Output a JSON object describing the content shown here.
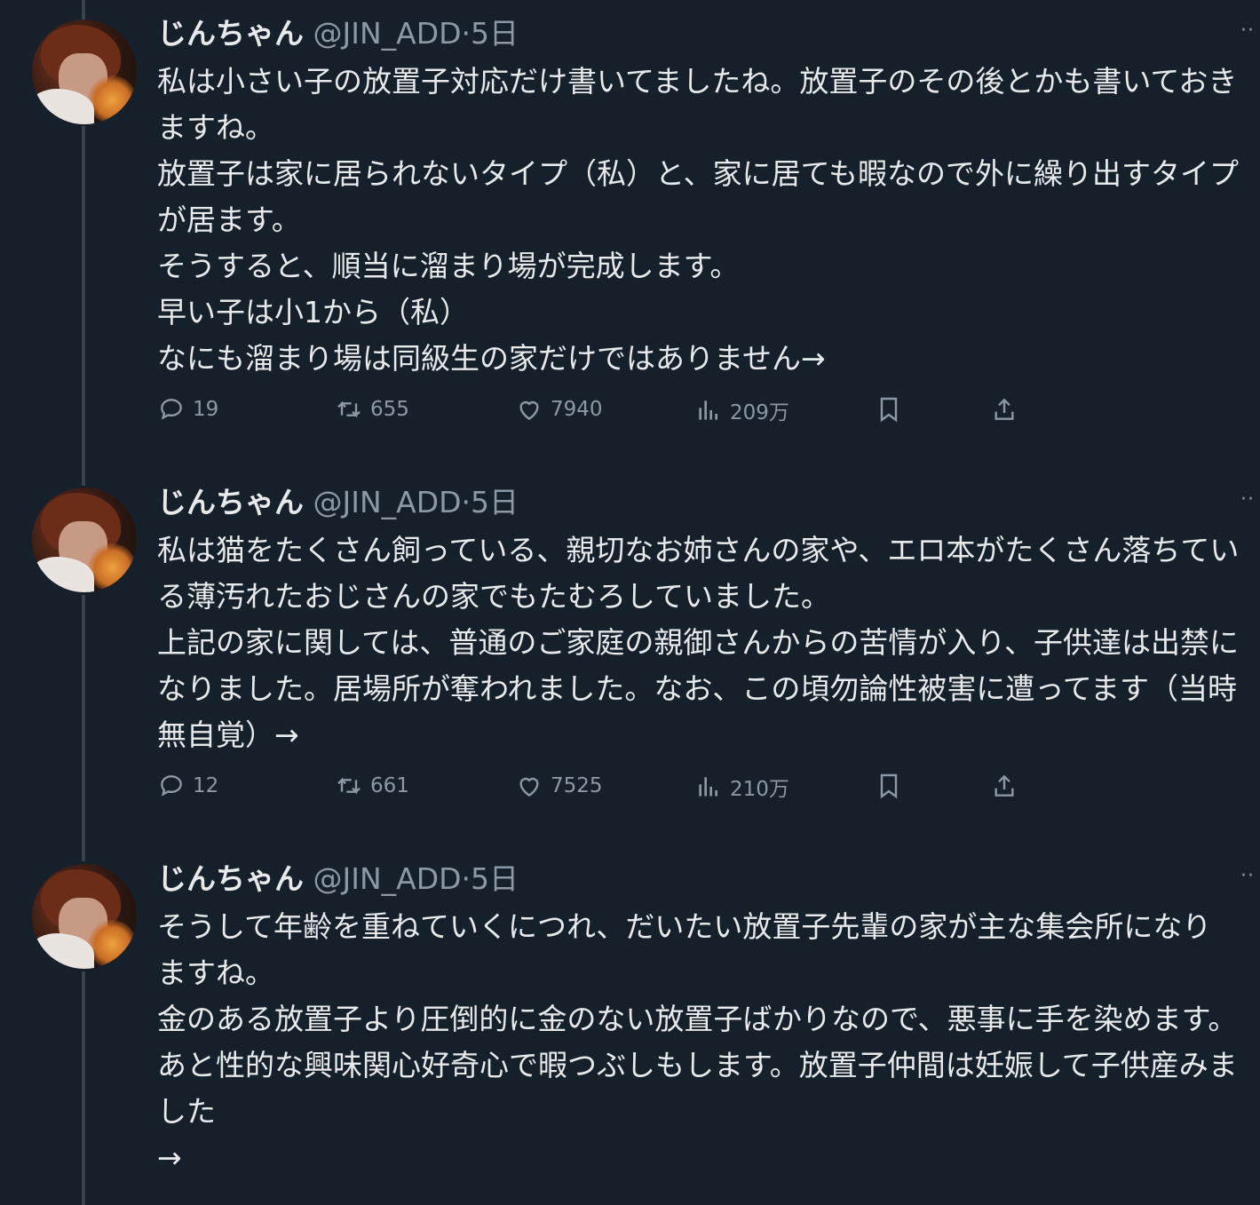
{
  "tweets": [
    {
      "name": "じんちゃん",
      "handle": "@JIN_ADD",
      "dot": "·",
      "time": "5日",
      "more": "··",
      "text": "私は小さい子の放置子対応だけ書いてましたね。放置子のその後とかも書いておきますね。\n放置子は家に居られないタイプ（私）と、家に居ても暇なので外に繰り出すタイプが居ます。\nそうすると、順当に溜まり場が完成します。\n早い子は小1から（私）\nなにも溜まり場は同級生の家だけではありません→",
      "replies": "19",
      "retweets": "655",
      "likes": "7940",
      "views": "209万"
    },
    {
      "name": "じんちゃん",
      "handle": "@JIN_ADD",
      "dot": "·",
      "time": "5日",
      "more": "··",
      "text": "私は猫をたくさん飼っている、親切なお姉さんの家や、エロ本がたくさん落ちている薄汚れたおじさんの家でもたむろしていました。\n上記の家に関しては、普通のご家庭の親御さんからの苦情が入り、子供達は出禁になりました。居場所が奪われました。なお、この頃勿論性被害に遭ってます（当時無自覚）→",
      "replies": "12",
      "retweets": "661",
      "likes": "7525",
      "views": "210万"
    },
    {
      "name": "じんちゃん",
      "handle": "@JIN_ADD",
      "dot": "·",
      "time": "5日",
      "more": "··",
      "text": "そうして年齢を重ねていくにつれ、だいたい放置子先輩の家が主な集会所になりますね。\n金のある放置子より圧倒的に金のない放置子ばかりなので、悪事に手を染めます。\nあと性的な興味関心好奇心で暇つぶしもします。放置子仲間は妊娠して子供産みました\n→"
    }
  ],
  "colors": {
    "background": "#15202b",
    "text": "#e7e9ea",
    "secondary": "#8b98a5",
    "thread_line": "#38444d"
  },
  "icons": {
    "reply": "reply-icon",
    "retweet": "retweet-icon",
    "like": "heart-icon",
    "views": "analytics-icon",
    "bookmark": "bookmark-icon",
    "share": "share-icon"
  }
}
